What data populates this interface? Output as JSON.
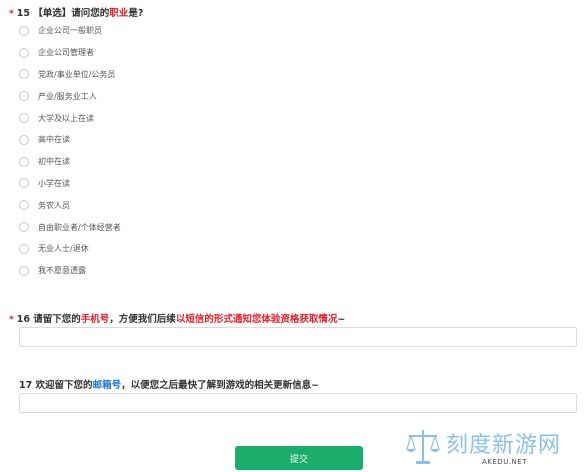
{
  "q15": {
    "required_mark": "*",
    "number": "15",
    "type_tag": "【单选】",
    "title_prefix": "请问您的",
    "title_highlight": "职业",
    "title_suffix": "是?",
    "options": [
      "企业公司一般职员",
      "企业公司管理者",
      "党政/事业单位/公务员",
      "产业/服务业工人",
      "大学及以上在读",
      "高中在读",
      "初中在读",
      "小学在读",
      "务农人员",
      "自由职业者/个体经营者",
      "无业人士/退休",
      "我不愿意透露"
    ]
  },
  "q16": {
    "required_mark": "*",
    "number": "16",
    "title_prefix": "请留下您的",
    "title_highlight1": "手机号",
    "title_middle": "，方便我们后续",
    "title_highlight2": "以短信的形式通知您体验资格获取情况",
    "title_suffix": "~",
    "value": ""
  },
  "q17": {
    "number": "17",
    "title_prefix": "欢迎留下您的",
    "title_highlight": "邮箱号",
    "title_suffix": "，以便您之后最快了解到游戏的相关更新信息~",
    "value": ""
  },
  "submit_label": "提交",
  "watermark": {
    "cn": "刻度新游网",
    "en": "AKEDU.NET",
    "icon": "scales-icon"
  },
  "colors": {
    "highlight_red": "#e0212a",
    "highlight_blue": "#1f74d6",
    "submit_green": "#1aad6b",
    "required_red": "#e02020",
    "watermark_blue": "#8cc0e8"
  }
}
